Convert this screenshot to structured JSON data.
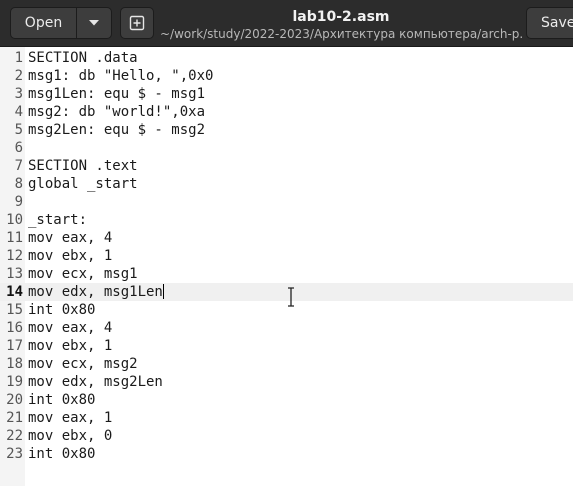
{
  "window": {
    "title": "lab10-2.asm",
    "subtitle": "~/work/study/2022-2023/Архитектура компьютера/arch-p..."
  },
  "toolbar": {
    "open_label": "Open",
    "open_menu_icon": "chevron-down-icon",
    "new_tab_icon": "new-document-icon",
    "save_label": "Save"
  },
  "editor": {
    "current_line": 14,
    "lines": [
      {
        "num": "1",
        "text": "SECTION .data"
      },
      {
        "num": "2",
        "text": "msg1: db \"Hello, \",0x0"
      },
      {
        "num": "3",
        "text": "msg1Len: equ $ - msg1"
      },
      {
        "num": "4",
        "text": "msg2: db \"world!\",0xa"
      },
      {
        "num": "5",
        "text": "msg2Len: equ $ - msg2"
      },
      {
        "num": "6",
        "text": ""
      },
      {
        "num": "7",
        "text": "SECTION .text"
      },
      {
        "num": "8",
        "text": "global _start"
      },
      {
        "num": "9",
        "text": ""
      },
      {
        "num": "10",
        "text": "_start:"
      },
      {
        "num": "11",
        "text": "mov eax, 4"
      },
      {
        "num": "12",
        "text": "mov ebx, 1"
      },
      {
        "num": "13",
        "text": "mov ecx, msg1"
      },
      {
        "num": "14",
        "text": "mov edx, msg1Len"
      },
      {
        "num": "15",
        "text": "int 0x80"
      },
      {
        "num": "16",
        "text": "mov eax, 4"
      },
      {
        "num": "17",
        "text": "mov ebx, 1"
      },
      {
        "num": "18",
        "text": "mov ecx, msg2"
      },
      {
        "num": "19",
        "text": "mov edx, msg2Len"
      },
      {
        "num": "20",
        "text": "int 0x80"
      },
      {
        "num": "21",
        "text": "mov eax, 1"
      },
      {
        "num": "22",
        "text": "mov ebx, 0"
      },
      {
        "num": "23",
        "text": "int 0x80"
      }
    ]
  }
}
